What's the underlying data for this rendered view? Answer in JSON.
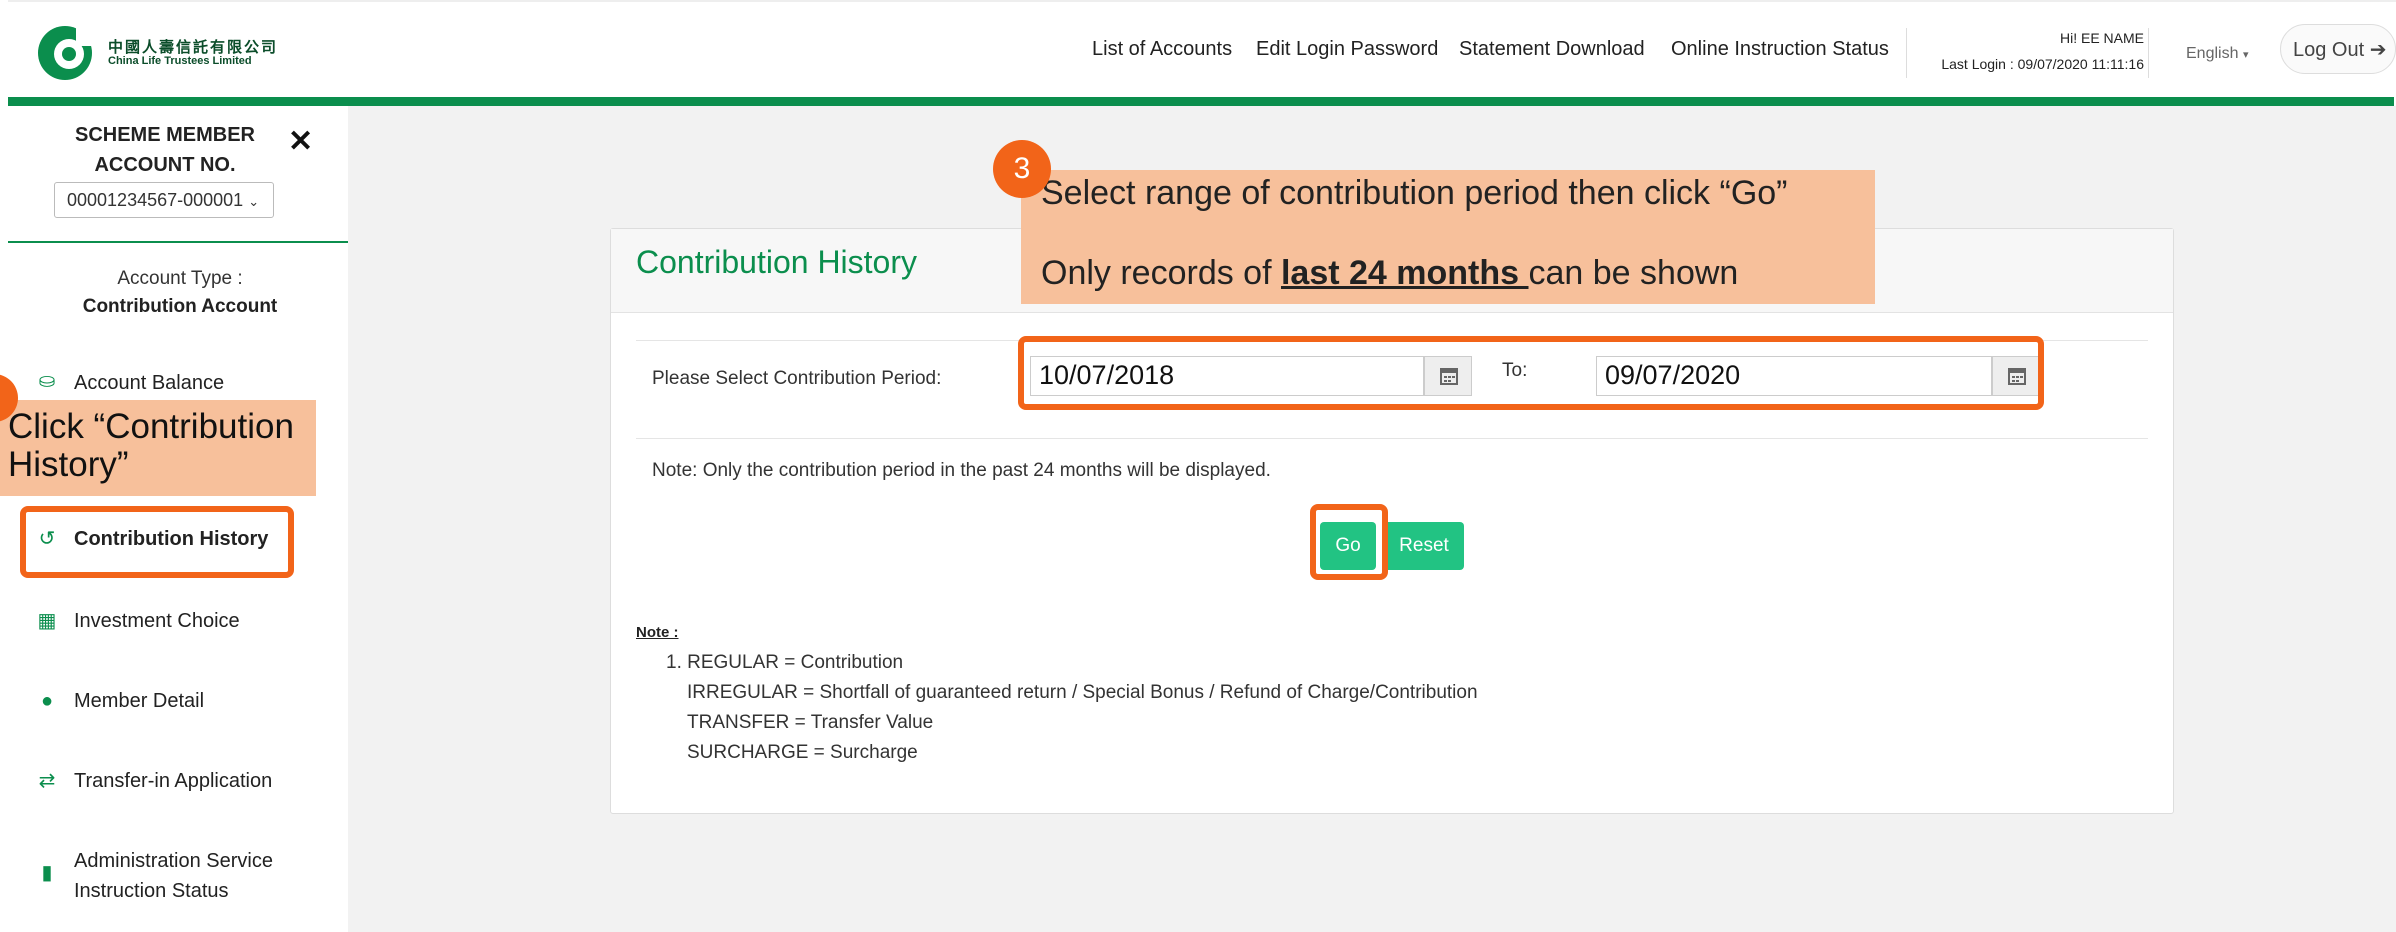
{
  "header": {
    "logo_cn": "中國人壽信託有限公司",
    "logo_en": "China Life Trustees Limited",
    "nav": [
      "List of Accounts",
      "Edit Login Password",
      "Statement Download",
      "Online Instruction Status"
    ],
    "greeting": "Hi! EE NAME",
    "last_login": "Last Login : 09/07/2020 11:11:16",
    "language": "English",
    "logout": "Log Out"
  },
  "sidebar": {
    "scheme_line1": "SCHEME MEMBER",
    "scheme_line2": "ACCOUNT NO.",
    "account_no": "00001234567-000001",
    "account_type_label": "Account Type :",
    "account_type_value": "Contribution Account",
    "items": [
      {
        "label": "Account Balance",
        "icon": "hand-coin-icon"
      },
      {
        "label": "Contribution History",
        "icon": "history-icon"
      },
      {
        "label": "Investment Choice",
        "icon": "table-icon"
      },
      {
        "label": "Member Detail",
        "icon": "info-icon"
      },
      {
        "label": "Transfer-in Application",
        "icon": "transfer-icon"
      },
      {
        "label": "Administration Service Instruction Status",
        "icon": "clipboard-icon"
      }
    ]
  },
  "main": {
    "title": "Contribution History",
    "period_label": "Please Select Contribution Period:",
    "from_date": "10/07/2018",
    "to_label": "To:",
    "to_date": "09/07/2020",
    "note_line": "Note: Only the contribution period in the past 24 months will be displayed.",
    "go": "Go",
    "reset": "Reset",
    "notes_title": "Note :",
    "notes": [
      "1. REGULAR = Contribution",
      "IRREGULAR = Shortfall of guaranteed return / Special Bonus / Refund of Charge/Contribution",
      "TRANSFER = Transfer Value",
      "SURCHARGE = Surcharge"
    ]
  },
  "callouts": {
    "step_number": "3",
    "top_line1": "Select range of contribution period then click “Go”",
    "top_line2_pre": "Only records of ",
    "top_line2_bold": "last 24 months ",
    "top_line2_post": "can be shown",
    "left_text": "Click  “Contribution History”"
  },
  "colors": {
    "brand_green": "#0b8e4d",
    "button_green": "#22c383",
    "highlight_orange": "#f26419",
    "callout_bg": "#f7c09b"
  }
}
